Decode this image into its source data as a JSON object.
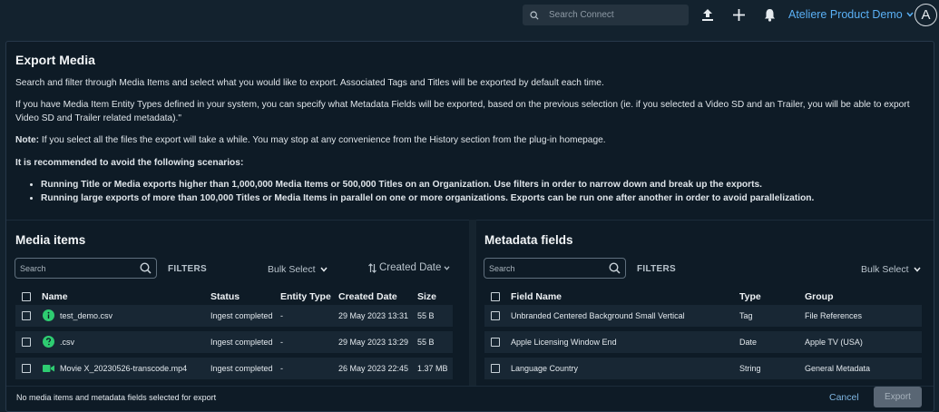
{
  "topbar": {
    "search_placeholder": "Search Connect",
    "org_name": "Ateliere Product Demo",
    "avatar_letter": "A"
  },
  "modal": {
    "title": "Export Media",
    "para1": "Search and filter through Media Items and select what you would like to export. Associated Tags and Titles will be exported by default each time.",
    "para2_line1": "If you have Media Item Entity Types defined in your system, you can specify what Metadata Fields will be exported, based on the previous selection (ie. if you selected a Video SD and an Trailer, you will be able to export",
    "para2_line2": "Video SD and Trailer related metadata).\"",
    "note_label": "Note:",
    "note_text": " If you select all the files the export will take a while. You may stop at any convenience from the History section from the plug-in homepage.",
    "recommend": "It is recommended to avoid the following scenarios:",
    "bullets": [
      "Running Title or Media exports higher than 1,000,000 Media Items or 500,000 Titles on an Organization. Use filters in order to narrow down and break up the exports.",
      "Running large exports of more than 100,000 Titles or Media Items in parallel on one or more organizations. Exports can be run one after another in order to avoid parallelization."
    ]
  },
  "media": {
    "title": "Media items",
    "search_placeholder": "Search",
    "filters": "FILTERS",
    "bulk": "Bulk Select",
    "sort": "Created Date",
    "columns": [
      "Name",
      "Status",
      "Entity Type",
      "Created Date",
      "Size"
    ],
    "rows": [
      {
        "name": "test_demo.csv",
        "status": "Ingest completed",
        "entity": "-",
        "date": "29 May 2023 13:31",
        "size": "55 B",
        "icon": "info-icon",
        "icon_color": "#2ecc71"
      },
      {
        "name": ".csv",
        "status": "Ingest completed",
        "entity": "-",
        "date": "29 May 2023 13:29",
        "size": "55 B",
        "icon": "question-icon",
        "icon_color": "#2ecc71"
      },
      {
        "name": "Movie X_20230526-transcode.mp4",
        "status": "Ingest completed",
        "entity": "-",
        "date": "26 May 2023 22:45",
        "size": "1.37 MB",
        "icon": "video-icon",
        "icon_color": "#2ecc71"
      }
    ]
  },
  "metadata": {
    "title": "Metadata fields",
    "search_placeholder": "Search",
    "filters": "FILTERS",
    "bulk": "Bulk Select",
    "columns": [
      "Field Name",
      "Type",
      "Group"
    ],
    "rows": [
      {
        "name": "Unbranded Centered Background Small Vertical",
        "type": "Tag",
        "group": "File References"
      },
      {
        "name": "Apple Licensing Window End",
        "type": "Date",
        "group": "Apple TV (USA)"
      },
      {
        "name": "Language Country",
        "type": "String",
        "group": "General Metadata"
      }
    ]
  },
  "footer": {
    "status": "No media items and metadata fields selected for export",
    "cancel": "Cancel",
    "export": "Export"
  }
}
